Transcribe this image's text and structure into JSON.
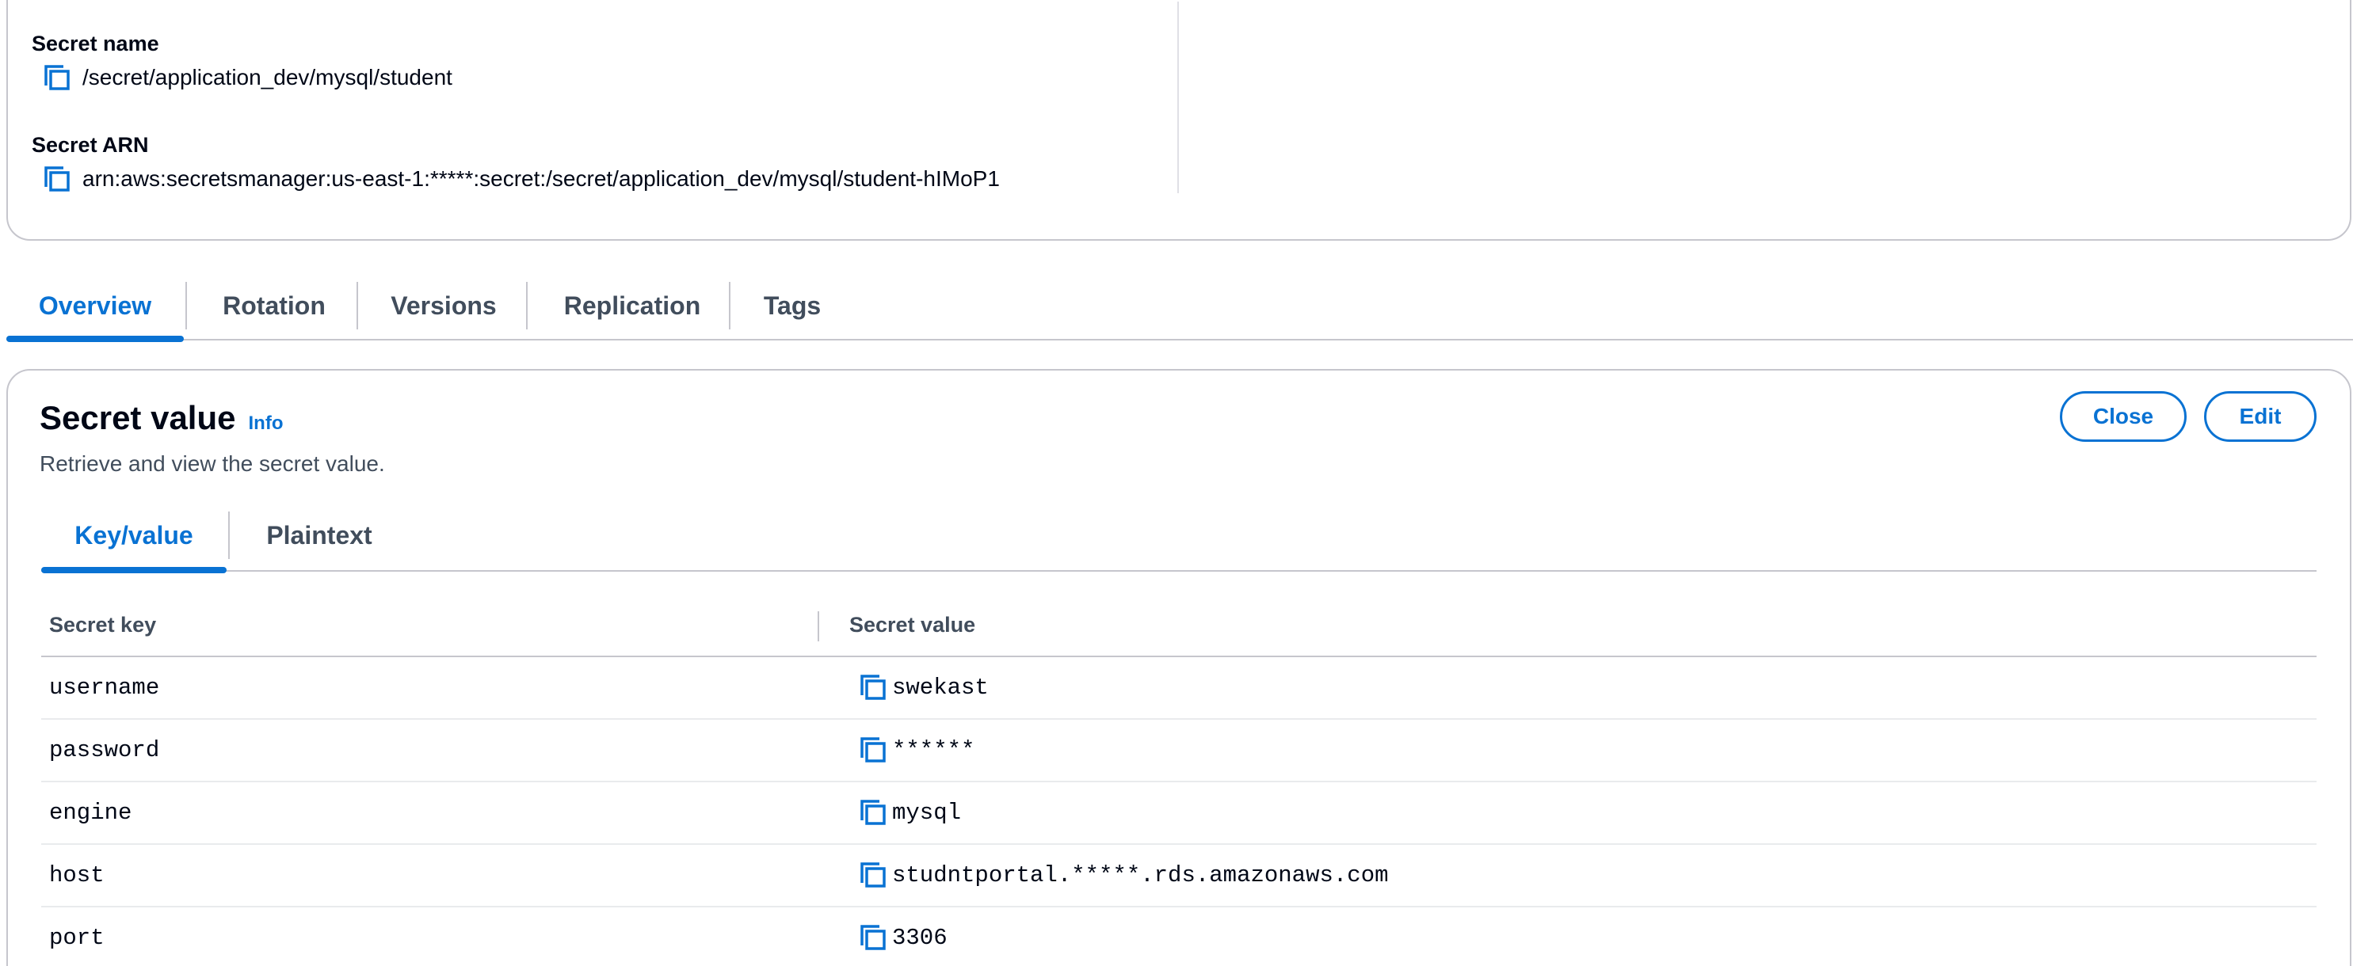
{
  "details": {
    "secret_name_label": "Secret name",
    "secret_name_value": "/secret/application_dev/mysql/student",
    "secret_arn_label": "Secret ARN",
    "secret_arn_value": "arn:aws:secretsmanager:us-east-1:*****:secret:/secret/application_dev/mysql/student-hIMoP1"
  },
  "main_tabs": [
    {
      "label": "Overview",
      "active": true
    },
    {
      "label": "Rotation",
      "active": false
    },
    {
      "label": "Versions",
      "active": false
    },
    {
      "label": "Replication",
      "active": false
    },
    {
      "label": "Tags",
      "active": false
    }
  ],
  "secret_value_card": {
    "title": "Secret value",
    "info_label": "Info",
    "description": "Retrieve and view the secret value.",
    "close_label": "Close",
    "edit_label": "Edit",
    "inner_tabs": [
      {
        "label": "Key/value",
        "active": true
      },
      {
        "label": "Plaintext",
        "active": false
      }
    ],
    "table": {
      "col_key": "Secret key",
      "col_value": "Secret value",
      "rows": [
        {
          "key": "username",
          "value": "swekast"
        },
        {
          "key": "password",
          "value": "******"
        },
        {
          "key": "engine",
          "value": "mysql"
        },
        {
          "key": "host",
          "value": "studntportal.*****.rds.amazonaws.com"
        },
        {
          "key": "port",
          "value": "3306"
        }
      ]
    }
  },
  "colors": {
    "accent": "#0972d3",
    "text": "#000716",
    "secondary_text": "#414d5c",
    "border": "#c6c6cd"
  },
  "icons": {
    "copy": "copy-icon"
  }
}
